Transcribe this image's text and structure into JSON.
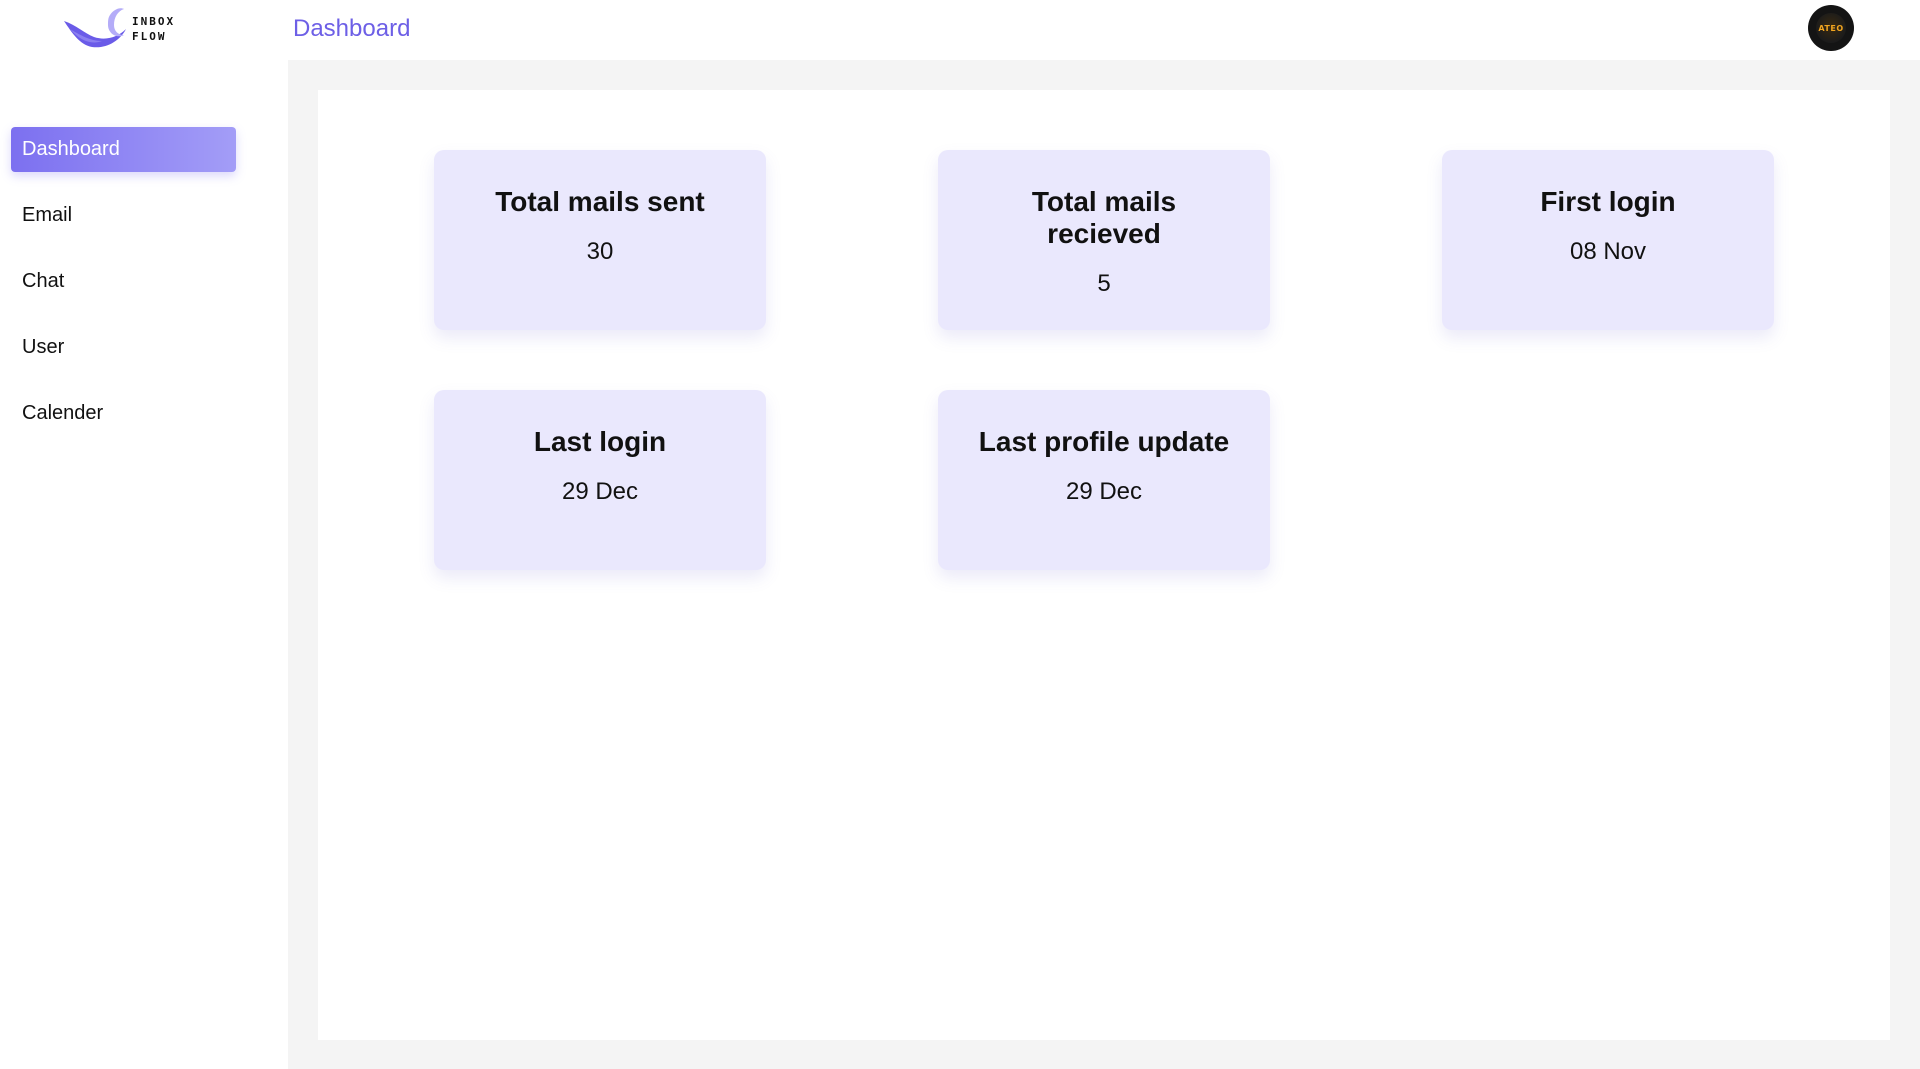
{
  "logo": {
    "line1": "INBOX",
    "line2": "FLOW"
  },
  "header": {
    "title": "Dashboard",
    "avatar_text": "ATEO"
  },
  "sidebar": {
    "items": [
      {
        "label": "Dashboard",
        "active": true
      },
      {
        "label": "Email",
        "active": false
      },
      {
        "label": "Chat",
        "active": false
      },
      {
        "label": "User",
        "active": false
      },
      {
        "label": "Calender",
        "active": false
      }
    ]
  },
  "cards": [
    {
      "title": "Total mails sent",
      "value": "30"
    },
    {
      "title": "Total mails recieved",
      "value": "5"
    },
    {
      "title": "First login",
      "value": "08 Nov"
    },
    {
      "title": "Last login",
      "value": "29 Dec"
    },
    {
      "title": "Last profile update",
      "value": "29 Dec"
    }
  ],
  "colors": {
    "accent": "#6d5fe6",
    "card_bg": "#eae8fd",
    "page_bg": "#f4f4f4"
  }
}
